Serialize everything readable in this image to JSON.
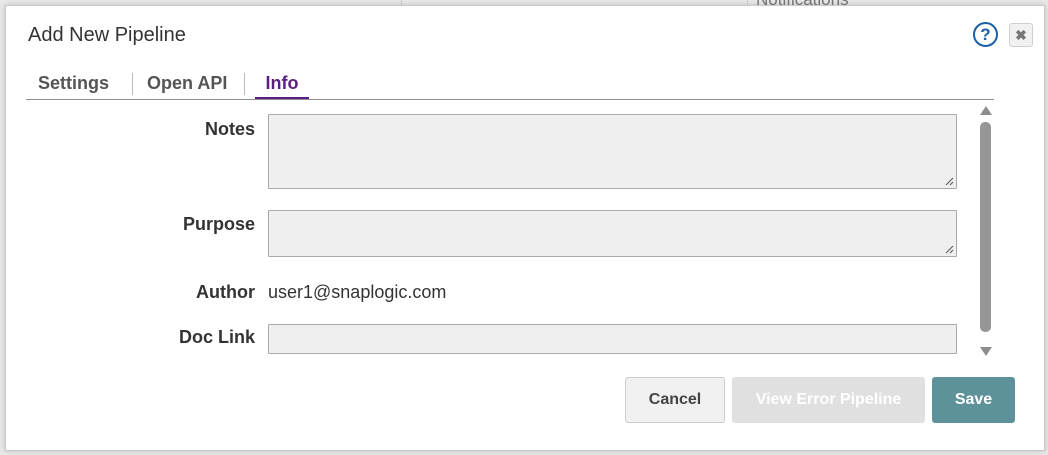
{
  "background": {
    "partial_text": "Notifications"
  },
  "dialog": {
    "title": "Add New Pipeline",
    "help_label": "?",
    "close_label": "✖"
  },
  "tabs": [
    {
      "label": "Settings",
      "active": false
    },
    {
      "label": "Open API",
      "active": false
    },
    {
      "label": "Info",
      "active": true
    }
  ],
  "form": {
    "notes": {
      "label": "Notes",
      "value": ""
    },
    "purpose": {
      "label": "Purpose",
      "value": ""
    },
    "author": {
      "label": "Author",
      "value": "user1@snaplogic.com"
    },
    "doc_link": {
      "label": "Doc Link",
      "value": ""
    }
  },
  "buttons": {
    "cancel": "Cancel",
    "view_error_pipeline": "View Error Pipeline",
    "save": "Save"
  },
  "colors": {
    "active_tab": "#5b1f84",
    "save_button": "#5e929b",
    "help_icon": "#1b5fa7"
  }
}
